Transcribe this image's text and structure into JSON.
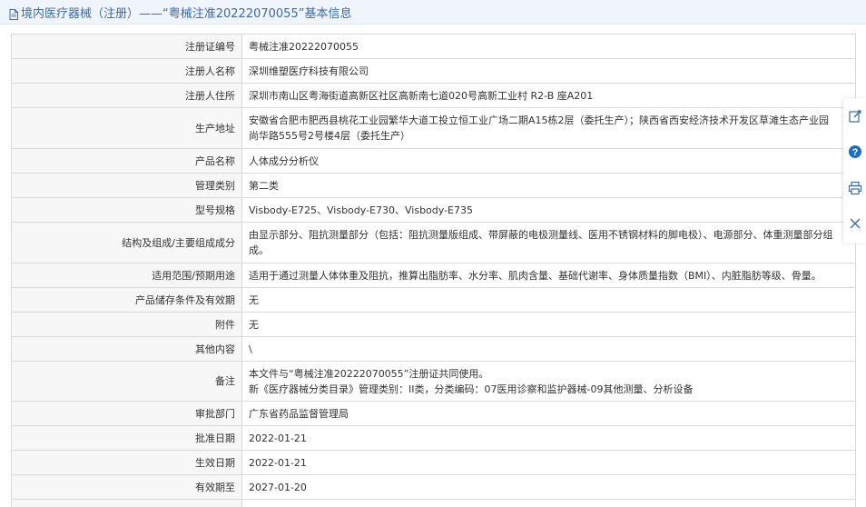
{
  "header": {
    "title": "境内医疗器械（注册）——“粤械注准20222070055”基本信息"
  },
  "rows": [
    {
      "label": "注册证编号",
      "value": "粤械注准20222070055"
    },
    {
      "label": "注册人名称",
      "value": "深圳维塑医疗科技有限公司"
    },
    {
      "label": "注册人住所",
      "value": "深圳市南山区粤海街道高新区社区高新南七道020号高新工业村 R2-B 座A201"
    },
    {
      "label": "生产地址",
      "value_line1": "安徽省合肥市肥西县桃花工业园繁华大道工投立恒工业广场二期A15栋2层（委托生产）；陕西省西安经济技术开发区草滩生态产业园",
      "value_line2": "尚华路555号2号楼4层（委托生产）"
    },
    {
      "label": "产品名称",
      "value": "人体成分分析仪"
    },
    {
      "label": "管理类别",
      "value": "第二类"
    },
    {
      "label": "型号规格",
      "value": "Visbody-E725、Visbody-E730、Visbody-E735"
    },
    {
      "label": "结构及组成/主要组成成分",
      "value_line1": "由显示部分、阻抗测量部分（包括：阻抗测量版组成、带屏蔽的电极测量线、医用不锈钢材料的脚电极）、电源部分、体重测量部分组",
      "value_line2": "成。"
    },
    {
      "label": "适用范围/预期用途",
      "value": "适用于通过测量人体体重及阻抗，推算出脂肪率、水分率、肌肉含量、基础代谢率、身体质量指数（BMI）、内脏脂肪等级、骨量。"
    },
    {
      "label": "产品储存条件及有效期",
      "value": "无"
    },
    {
      "label": "附件",
      "value": "无"
    },
    {
      "label": "其他内容",
      "value": "\\"
    },
    {
      "label": "备注",
      "value_line1": "本文件与“粤械注准20222070055”注册证共同使用。",
      "value_line2": "新《医疗器械分类目录》管理类别：II类，分类编码：07医用诊察和监护器械-09其他测量、分析设备"
    },
    {
      "label": "审批部门",
      "value": "广东省药品监督管理局"
    },
    {
      "label": "批准日期",
      "value": "2022-01-21"
    },
    {
      "label": "生效日期",
      "value": "2022-01-21"
    },
    {
      "label": "有效期至",
      "value": "2027-01-20"
    },
    {
      "label": "",
      "value": ""
    }
  ],
  "side_tools": [
    {
      "icon": "edit-icon"
    },
    {
      "icon": "info-icon"
    },
    {
      "icon": "print-icon"
    },
    {
      "icon": "close-icon"
    }
  ],
  "colors": {
    "title_text": "#3d6aa8",
    "title_bg": "#f0f4fb",
    "label_bg": "#f7f7f7",
    "border": "#d9d9d9",
    "info_icon": "#1a6fc4"
  }
}
